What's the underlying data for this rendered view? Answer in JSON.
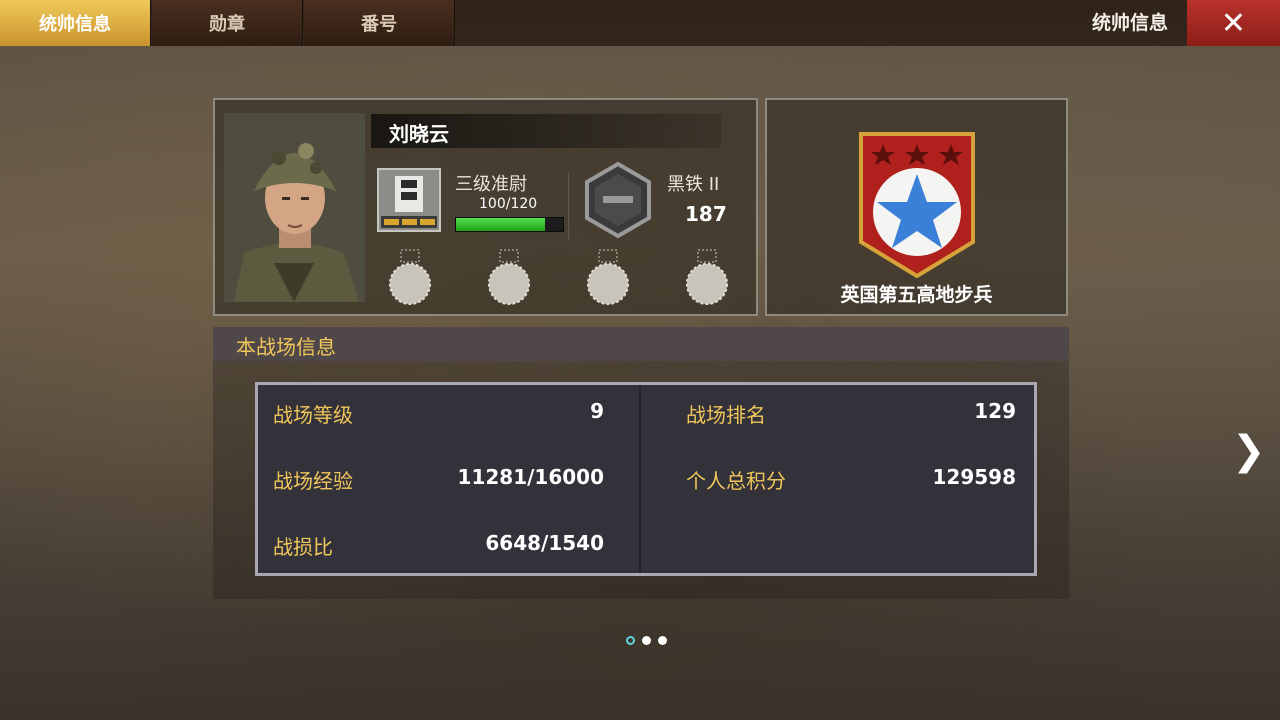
{
  "tabs": [
    {
      "label": "统帅信息",
      "active": true
    },
    {
      "label": "勋章",
      "active": false
    },
    {
      "label": "番号",
      "active": false
    }
  ],
  "header": {
    "title": "统帅信息",
    "close_icon": "close-icon"
  },
  "profile": {
    "name": "刘晓云",
    "rank": {
      "name": "三级准尉",
      "xp_text": "100/120",
      "xp_progress": 0.83
    },
    "tier": {
      "name": "黑铁 II",
      "score": "187"
    },
    "medal_slots": 4
  },
  "unit": {
    "name": "英国第五高地步兵",
    "emblem_icon": "star-shield-icon"
  },
  "battle_info": {
    "title": "本战场信息",
    "left": [
      {
        "label": "战场等级",
        "value": "9"
      },
      {
        "label": "战场经验",
        "value": "11281/16000"
      },
      {
        "label": "战损比",
        "value": "6648/1540"
      }
    ],
    "right": [
      {
        "label": "战场排名",
        "value": "129"
      },
      {
        "label": "个人总积分",
        "value": "129598"
      }
    ]
  },
  "pagination": {
    "pages": 3,
    "current": 1
  },
  "colors": {
    "accent_gold": "#f0c75a",
    "close_red": "#b8322b",
    "xp_green": "#3ccf37"
  }
}
